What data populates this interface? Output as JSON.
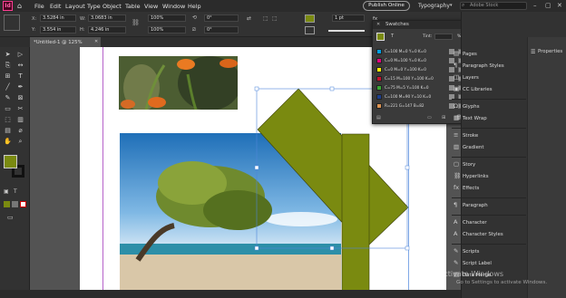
{
  "menubar": {
    "items": [
      "File",
      "Edit",
      "Layout",
      "Type",
      "Object",
      "Table",
      "View",
      "Window",
      "Help"
    ],
    "publish_label": "Publish Online",
    "workspace": "Typography",
    "search_placeholder": "Adobe Stock"
  },
  "control": {
    "x_label": "X:",
    "x_value": "3.5284 in",
    "y_label": "Y:",
    "y_value": "3.554 in",
    "w_label": "W:",
    "w_value": "3.0683 in",
    "h_label": "H:",
    "h_value": "4.246 in",
    "scale_x": "100%",
    "scale_y": "100%",
    "angle": "0°",
    "shear": "0°",
    "stroke_weight": "1 pt",
    "opacity": "100%",
    "fill_color": "#7a8a10"
  },
  "document": {
    "tab_label": "*Untitled-1 @ 125%"
  },
  "swatches": {
    "title": "Swatches",
    "tint_label": "Tint:",
    "tint_unit": "%",
    "rows": [
      {
        "name": "C=100 M=0 Y=0 K=0",
        "color": "#009fe3"
      },
      {
        "name": "C=0 M=100 Y=0 K=0",
        "color": "#e5007e"
      },
      {
        "name": "C=0 M=0 Y=100 K=0",
        "color": "#ffed00"
      },
      {
        "name": "C=15 M=100 Y=100 K=0",
        "color": "#c8102e"
      },
      {
        "name": "C=75 M=5 Y=100 K=0",
        "color": "#3aa935"
      },
      {
        "name": "C=100 M=90 Y=10 K=0",
        "color": "#1d3f8f"
      },
      {
        "name": "R=221 G=147 B=82",
        "color": "#dd9352"
      }
    ]
  },
  "dock": {
    "properties_label": "Properties",
    "items": [
      {
        "icon": "pages-icon",
        "glyph": "▤",
        "label": "Pages"
      },
      {
        "icon": "paragraph-styles-icon",
        "glyph": "¶",
        "label": "Paragraph Styles"
      },
      {
        "icon": "layers-icon",
        "glyph": "◫",
        "label": "Layers"
      },
      {
        "icon": "cc-libraries-icon",
        "glyph": "▣",
        "label": "CC Libraries"
      },
      {
        "icon": "glyphs-icon",
        "glyph": "Ω",
        "label": "Glyphs"
      },
      {
        "icon": "text-wrap-icon",
        "glyph": "▦",
        "label": "Text Wrap"
      },
      {
        "icon": "stroke-icon",
        "glyph": "≡",
        "label": "Stroke"
      },
      {
        "icon": "gradient-icon",
        "glyph": "▥",
        "label": "Gradient"
      },
      {
        "icon": "story-icon",
        "glyph": "▢",
        "label": "Story"
      },
      {
        "icon": "hyperlinks-icon",
        "glyph": "⛓",
        "label": "Hyperlinks"
      },
      {
        "icon": "effects-icon",
        "glyph": "fx",
        "label": "Effects"
      },
      {
        "icon": "paragraph-icon",
        "glyph": "¶",
        "label": "Paragraph"
      },
      {
        "icon": "character-icon",
        "glyph": "A",
        "label": "Character"
      },
      {
        "icon": "character-styles-icon",
        "glyph": "A",
        "label": "Character Styles"
      },
      {
        "icon": "scripts-icon",
        "glyph": "✎",
        "label": "Scripts"
      },
      {
        "icon": "script-label-icon",
        "glyph": "✎",
        "label": "Script Label"
      },
      {
        "icon": "data-merge-icon",
        "glyph": "▤",
        "label": "Data Merge"
      }
    ]
  },
  "watermark": {
    "title": "Activate Windows",
    "subtitle": "Go to Settings to activate Windows."
  }
}
